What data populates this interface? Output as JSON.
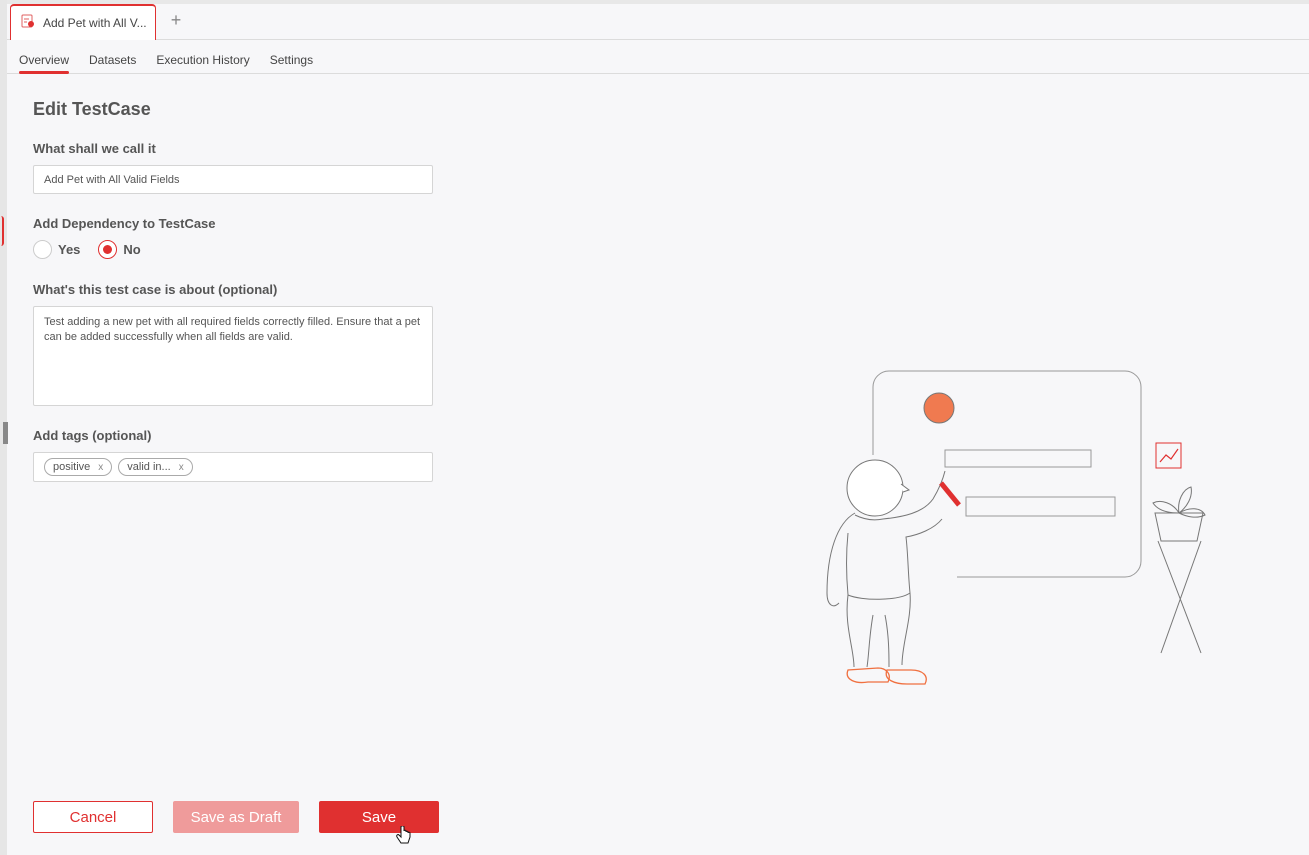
{
  "window": {
    "tab_label": "Add Pet with All V...",
    "add_tab_label": "+"
  },
  "subnav": {
    "tabs": [
      {
        "label": "Overview",
        "active": true
      },
      {
        "label": "Datasets",
        "active": false
      },
      {
        "label": "Execution History",
        "active": false
      },
      {
        "label": "Settings",
        "active": false
      }
    ]
  },
  "form": {
    "title": "Edit TestCase",
    "name_label": "What shall we call it",
    "name_value": "Add Pet with All Valid Fields",
    "dependency_label": "Add Dependency to TestCase",
    "dependency_options": [
      {
        "label": "Yes",
        "checked": false
      },
      {
        "label": "No",
        "checked": true
      }
    ],
    "description_label": "What's this test case is about (optional)",
    "description_value": "Test adding a new pet with all required fields correctly filled. Ensure that a pet can be added successfully when all fields are valid.",
    "tags_label": "Add tags (optional)",
    "tags": [
      {
        "label": "positive",
        "remove": "x"
      },
      {
        "label": "valid in...",
        "remove": "x"
      }
    ]
  },
  "actions": {
    "cancel": "Cancel",
    "save_draft": "Save as Draft",
    "save": "Save"
  },
  "colors": {
    "accent": "#e03030",
    "accent_disabled": "#ef9b9b",
    "illustration_orange": "#f07040"
  }
}
